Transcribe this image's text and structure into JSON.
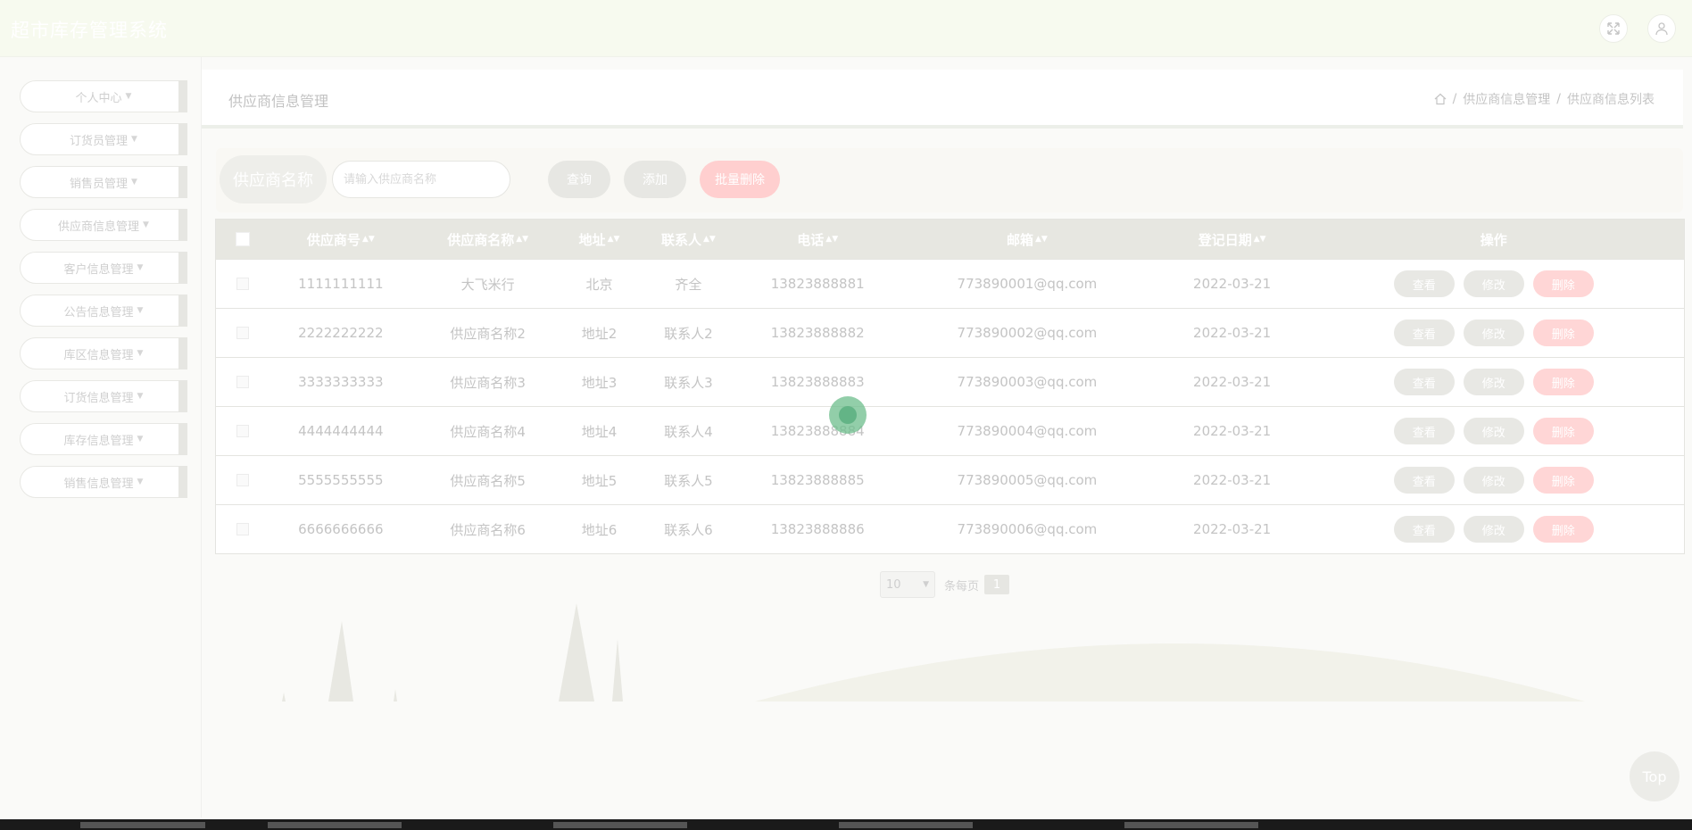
{
  "header": {
    "app_title": "超市库存管理系统",
    "fullscreen_icon": "expand-icon",
    "user_icon": "user-icon"
  },
  "sidebar": {
    "items": [
      {
        "label": "个人中心"
      },
      {
        "label": "订货员管理"
      },
      {
        "label": "销售员管理"
      },
      {
        "label": "供应商信息管理"
      },
      {
        "label": "客户信息管理"
      },
      {
        "label": "公告信息管理"
      },
      {
        "label": "库区信息管理"
      },
      {
        "label": "订货信息管理"
      },
      {
        "label": "库存信息管理"
      },
      {
        "label": "销售信息管理"
      }
    ]
  },
  "page": {
    "title": "供应商信息管理",
    "breadcrumb": [
      "供应商信息管理",
      "供应商信息列表"
    ]
  },
  "search": {
    "label": "供应商名称",
    "placeholder": "请输入供应商名称",
    "query_label": "查询",
    "add_label": "添加",
    "batch_delete_label": "批量删除"
  },
  "table": {
    "columns": [
      "供应商号",
      "供应商名称",
      "地址",
      "联系人",
      "电话",
      "邮箱",
      "登记日期",
      "操作"
    ],
    "actions": {
      "view": "查看",
      "edit": "修改",
      "delete": "删除"
    },
    "rows": [
      [
        "1111111111",
        "大飞米行",
        "北京",
        "齐全",
        "13823888881",
        "773890001@qq.com",
        "2022-03-21"
      ],
      [
        "2222222222",
        "供应商名称2",
        "地址2",
        "联系人2",
        "13823888882",
        "773890002@qq.com",
        "2022-03-21"
      ],
      [
        "3333333333",
        "供应商名称3",
        "地址3",
        "联系人3",
        "13823888883",
        "773890003@qq.com",
        "2022-03-21"
      ],
      [
        "4444444444",
        "供应商名称4",
        "地址4",
        "联系人4",
        "13823888884",
        "773890004@qq.com",
        "2022-03-21"
      ],
      [
        "5555555555",
        "供应商名称5",
        "地址5",
        "联系人5",
        "13823888885",
        "773890005@qq.com",
        "2022-03-21"
      ],
      [
        "6666666666",
        "供应商名称6",
        "地址6",
        "联系人6",
        "13823888886",
        "773890006@qq.com",
        "2022-03-21"
      ]
    ]
  },
  "pagination": {
    "page_size": "10",
    "per_page_label": "条每页",
    "current_page": "1"
  },
  "back_to_top": "Top"
}
